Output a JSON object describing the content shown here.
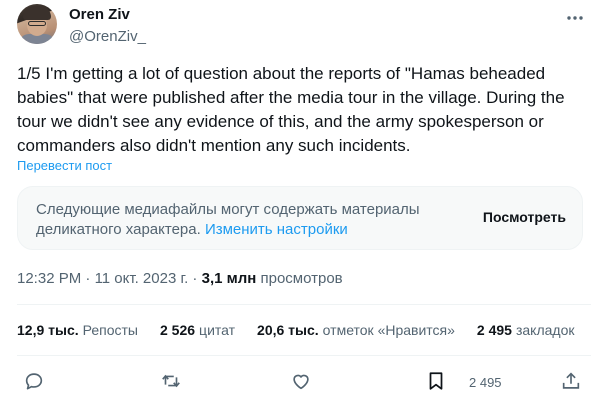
{
  "author": {
    "name": "Oren Ziv",
    "handle": "@OrenZiv_"
  },
  "tweet": {
    "text": "1/5 I'm getting a lot of question about the reports of \"Hamas beheaded babies\" that were published after the media tour in the village. During the tour we didn't see any evidence of this, and the army spokesperson or commanders also didn't mention any such incidents.",
    "translate_label": "Перевести пост"
  },
  "sensitive_notice": {
    "text": "Следующие медиафайлы могут содержать материалы деликатного характера.",
    "link": "Изменить настройки",
    "button": "Посмотреть"
  },
  "meta": {
    "time": "12:32 PM",
    "sep1": " · ",
    "date": "11 окт. 2023 г.",
    "sep2": " · ",
    "views_count": "3,1 млн",
    "views_label": "просмотров"
  },
  "stats": [
    {
      "count": "12,9 тыс.",
      "label": "Репосты"
    },
    {
      "count": "2 526",
      "label": "цитат"
    },
    {
      "count": "20,6 тыс.",
      "label": "отметок «Нравится»"
    },
    {
      "count": "2 495",
      "label": "закладок"
    }
  ],
  "actions": {
    "bookmark_count": "2 495",
    "icons": [
      "reply-icon",
      "repost-icon",
      "like-icon",
      "bookmark-icon",
      "share-icon"
    ]
  },
  "colors": {
    "text": "#0f1419",
    "secondary": "#536471",
    "accent": "#1d9bf0",
    "border": "#eff3f4"
  }
}
